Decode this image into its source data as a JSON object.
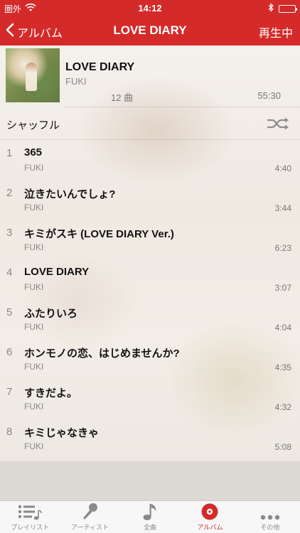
{
  "status": {
    "carrier": "圏外",
    "time": "14:12",
    "icons": [
      "wifi-icon",
      "bluetooth-icon",
      "battery-icon"
    ]
  },
  "nav": {
    "back_label": "アルバム",
    "title": "LOVE DIARY",
    "right_label": "再生中"
  },
  "album": {
    "title": "LOVE DIARY",
    "artist": "FUKI",
    "count": "12 曲",
    "duration": "55:30"
  },
  "shuffle": {
    "label": "シャッフル"
  },
  "tracks": [
    {
      "num": "1",
      "title": "365",
      "artist": "FUKI",
      "duration": "4:40"
    },
    {
      "num": "2",
      "title": "泣きたいんでしょ?",
      "artist": "FUKI",
      "duration": "3:44"
    },
    {
      "num": "3",
      "title": "キミがスキ (LOVE DIARY Ver.)",
      "artist": "FUKI",
      "duration": "6:23"
    },
    {
      "num": "4",
      "title": "LOVE DIARY",
      "artist": "FUKI",
      "duration": "3:07"
    },
    {
      "num": "5",
      "title": "ふたりいろ",
      "artist": "FUKI",
      "duration": "4:04"
    },
    {
      "num": "6",
      "title": "ホンモノの恋、はじめませんか?",
      "artist": "FUKI",
      "duration": "4:35"
    },
    {
      "num": "7",
      "title": "すきだよ。",
      "artist": "FUKI",
      "duration": "4:32"
    },
    {
      "num": "8",
      "title": "キミじゃなきゃ",
      "artist": "FUKI",
      "duration": "5:08"
    }
  ],
  "tabs": [
    {
      "label": "プレイリスト",
      "icon": "playlist-icon",
      "active": false
    },
    {
      "label": "アーティスト",
      "icon": "microphone-icon",
      "active": false
    },
    {
      "label": "全曲",
      "icon": "music-note-icon",
      "active": false
    },
    {
      "label": "アルバム",
      "icon": "album-disc-icon",
      "active": true
    },
    {
      "label": "その他",
      "icon": "more-icon",
      "active": false
    }
  ],
  "colors": {
    "accent": "#d42a2a",
    "tab_inactive": "#8a8a8a"
  }
}
